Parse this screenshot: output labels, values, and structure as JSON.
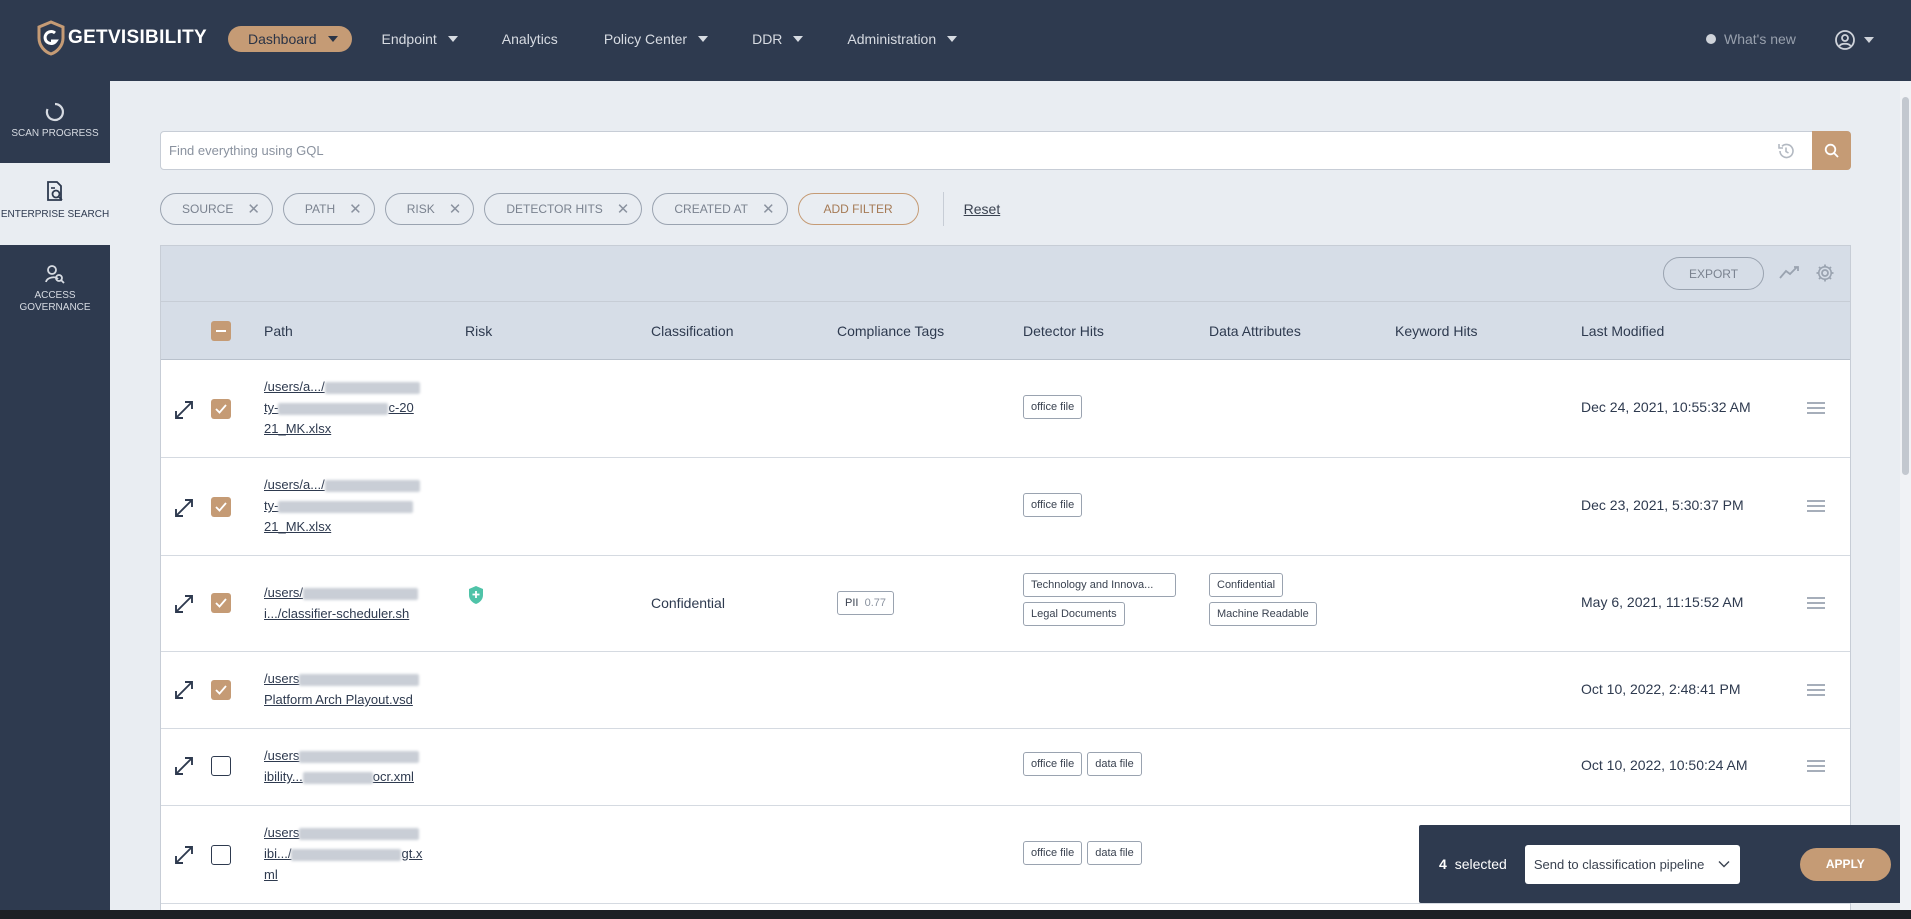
{
  "brand": {
    "name": "GETVISIBILITY"
  },
  "nav": {
    "items": [
      {
        "label": "Dashboard",
        "has_caret": true,
        "active": true
      },
      {
        "label": "Endpoint",
        "has_caret": true
      },
      {
        "label": "Analytics",
        "has_caret": false
      },
      {
        "label": "Policy Center",
        "has_caret": true
      },
      {
        "label": "DDR",
        "has_caret": true
      },
      {
        "label": "Administration",
        "has_caret": true
      }
    ],
    "whats_new": "What's new"
  },
  "sidebar": {
    "items": [
      {
        "label": "SCAN PROGRESS",
        "icon": "scan-progress-icon"
      },
      {
        "label": "ENTERPRISE SEARCH",
        "icon": "enterprise-search-icon",
        "active": true
      },
      {
        "label": "ACCESS GOVERNANCE",
        "icon": "access-governance-icon"
      }
    ]
  },
  "search": {
    "placeholder": "Find everything using GQL",
    "value": ""
  },
  "filters": {
    "chips": [
      "SOURCE",
      "PATH",
      "RISK",
      "DETECTOR HITS",
      "CREATED AT"
    ],
    "add_label": "ADD FILTER",
    "reset_label": "Reset"
  },
  "toolbar": {
    "export_label": "EXPORT"
  },
  "table": {
    "columns": [
      "Path",
      "Risk",
      "Classification",
      "Compliance Tags",
      "Detector Hits",
      "Data Attributes",
      "Keyword Hits",
      "Last Modified"
    ],
    "rows": [
      {
        "checked": true,
        "path_lines": [
          "/users/a.../",
          "ty-",
          "21_MK.xlsx"
        ],
        "path_tail": [
          "",
          "c-20",
          ""
        ],
        "risk": "",
        "classification": "",
        "compliance": [],
        "detector_hits": [
          "office file"
        ],
        "data_attributes": [],
        "keyword_hits": "",
        "last_modified": "Dec 24, 2021, 10:55:32 AM"
      },
      {
        "checked": true,
        "path_lines": [
          "/users/a.../",
          "ty-",
          "21_MK.xlsx"
        ],
        "path_tail": [
          "",
          "",
          ""
        ],
        "risk": "",
        "classification": "",
        "compliance": [],
        "detector_hits": [
          "office file"
        ],
        "data_attributes": [],
        "keyword_hits": "",
        "last_modified": "Dec 23, 2021, 5:30:37 PM"
      },
      {
        "checked": true,
        "path_lines": [
          "/users/",
          "i.../classifier-scheduler.sh"
        ],
        "path_tail": [
          "",
          ""
        ],
        "risk": "shield",
        "classification": "Confidential",
        "compliance": [
          {
            "label": "PII",
            "score": "0.77"
          }
        ],
        "detector_hits": [
          "Technology and Innova...",
          "Legal Documents"
        ],
        "data_attributes": [
          "Confidential",
          "Machine Readable"
        ],
        "keyword_hits": "",
        "last_modified": "May 6, 2021, 11:15:52 AM"
      },
      {
        "checked": true,
        "path_lines": [
          "/users",
          "Platform Arch Playout.vsd"
        ],
        "path_tail": [
          "",
          ""
        ],
        "risk": "",
        "classification": "",
        "compliance": [],
        "detector_hits": [],
        "data_attributes": [],
        "keyword_hits": "",
        "last_modified": "Oct 10, 2022, 2:48:41 PM"
      },
      {
        "checked": false,
        "path_lines": [
          "/users",
          "ibility...",
          ""
        ],
        "path_tail": [
          "",
          "ocr.xml",
          ""
        ],
        "risk": "",
        "classification": "",
        "compliance": [],
        "detector_hits": [
          "office file",
          "data file"
        ],
        "data_attributes": [],
        "keyword_hits": "",
        "last_modified": "Oct 10, 2022, 10:50:24 AM"
      },
      {
        "checked": false,
        "path_lines": [
          "/users",
          "ibi.../",
          "ml"
        ],
        "path_tail": [
          "",
          "gt.x",
          ""
        ],
        "risk": "",
        "classification": "",
        "compliance": [],
        "detector_hits": [
          "office file",
          "data file"
        ],
        "data_attributes": [],
        "keyword_hits": "",
        "last_modified": ""
      }
    ]
  },
  "selection": {
    "count": "4",
    "count_suffix": "selected",
    "action": "Send to classification pipeline",
    "apply_label": "APPLY"
  },
  "colors": {
    "navy": "#2e3a4f",
    "accent": "#c59b75",
    "background": "#e9edf2"
  }
}
